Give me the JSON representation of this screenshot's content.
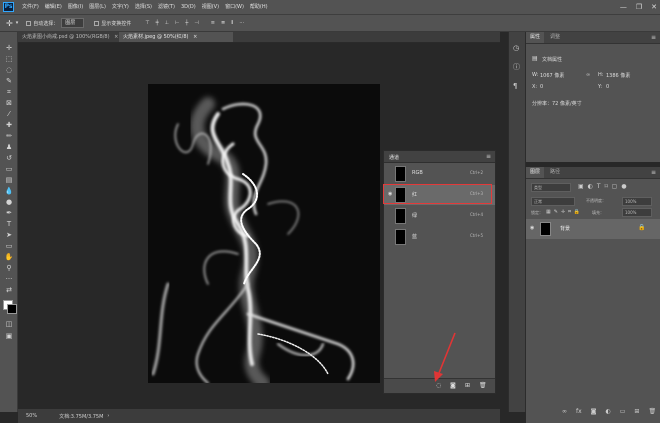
{
  "menubar": {
    "app_icon": "Ps",
    "menus": [
      "文件(F)",
      "编辑(E)",
      "图像(I)",
      "图层(L)",
      "文字(Y)",
      "选择(S)",
      "滤镜(T)",
      "3D(D)",
      "视图(V)",
      "窗口(W)",
      "帮助(H)"
    ],
    "window_minimize": "—",
    "window_restore": "❐",
    "window_close": "✕"
  },
  "options": {
    "auto_select_label": "自动选择：",
    "auto_select_value": "图层",
    "transform_label": "显示变换控件"
  },
  "tabs": [
    {
      "label": "火焰素图小尚戒.psd @ 100%(RGB/8)",
      "close": "×"
    },
    {
      "label": "火焰素材.jpeg @ 50%(红/8)",
      "close": "×"
    }
  ],
  "status": {
    "zoom": "50%",
    "doc": "文档:3.75M/3.75M"
  },
  "channels": {
    "title": "通道",
    "items": [
      {
        "name": "RGB",
        "shortcut": "Ctrl+2"
      },
      {
        "name": "红",
        "shortcut": "Ctrl+3"
      },
      {
        "name": "绿",
        "shortcut": "Ctrl+4"
      },
      {
        "name": "蓝",
        "shortcut": "Ctrl+5"
      }
    ]
  },
  "properties": {
    "tab_properties": "属性",
    "tab_adjust": "调整",
    "doc_props": "文档属性",
    "width_label": "W:",
    "width_value": "1067 像素",
    "height_label": "H:",
    "height_value": "1386 像素",
    "x_label": "X:",
    "x_value": "0",
    "y_label": "Y:",
    "y_value": "0",
    "resolution": "分辨率：72 像素/英寸"
  },
  "layers": {
    "tab_layers": "图层",
    "tab_paths": "路径",
    "filter_kind": "类型",
    "blend_mode": "正常",
    "opacity_label": "不透明度：",
    "opacity_value": "100%",
    "lock_label": "锁定：",
    "fill_label": "填充：",
    "fill_value": "100%",
    "layer_name": "背景"
  },
  "colors": {
    "accent_red": "#e43a3a",
    "arrow_red": "#e03535"
  }
}
